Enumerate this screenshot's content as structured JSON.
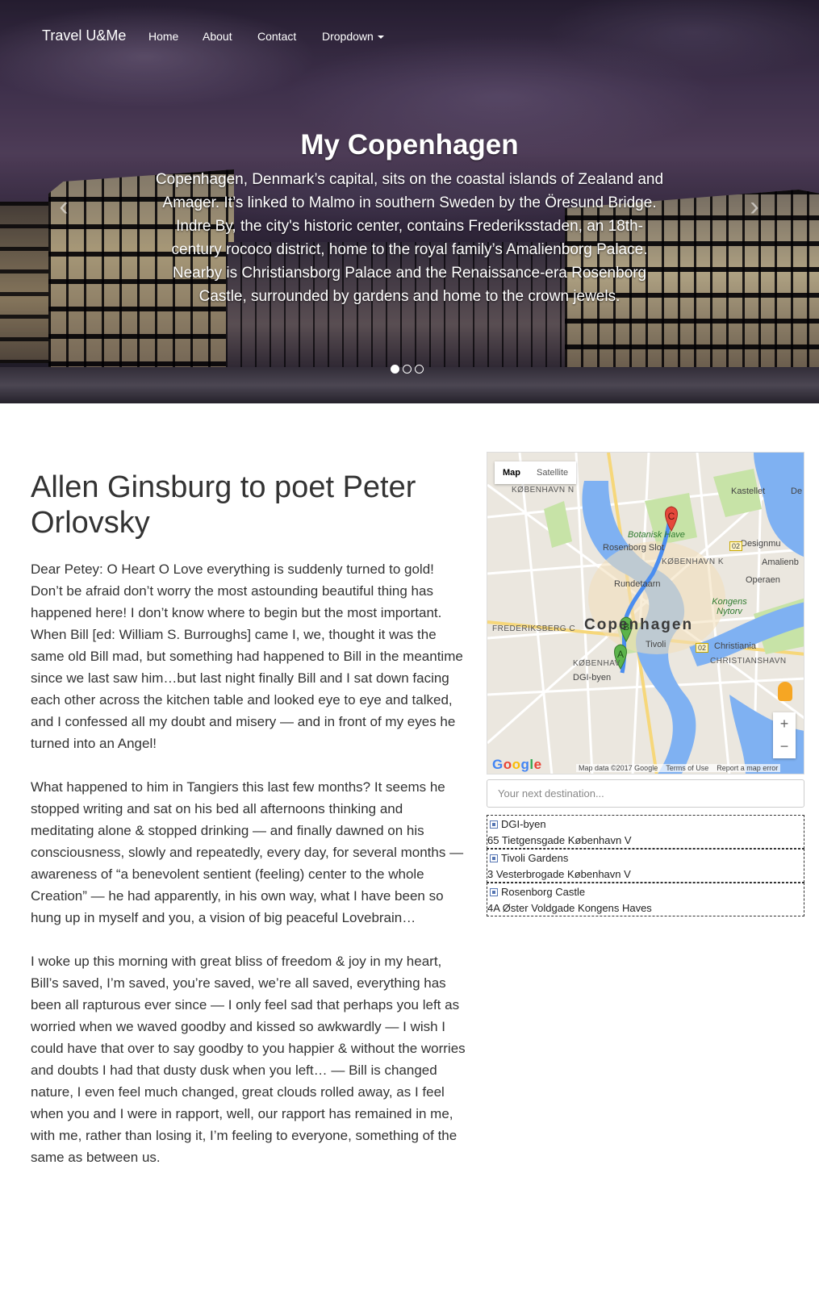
{
  "nav": {
    "brand": "Travel U&Me",
    "links": [
      "Home",
      "About",
      "Contact"
    ],
    "dropdown": "Dropdown"
  },
  "carousel": {
    "title": "My Copenhagen",
    "text": "Copenhagen, Denmark’s capital, sits on the coastal islands of Zealand and Amager. It’s linked to Malmo in southern Sweden by the Öresund Bridge. Indre By, the city's historic center, contains Frederiksstaden, an 18th-century rococo district, home to the royal family’s Amalienborg Palace. Nearby is Christiansborg Palace and the Renaissance-era Rosenborg Castle, surrounded by gardens and home to the crown jewels.",
    "prev": "‹",
    "next": "›",
    "slides": 3,
    "active_slide": 1
  },
  "article": {
    "title": "Allen Ginsburg to poet Peter Orlovsky",
    "paragraphs": [
      "Dear Petey: O Heart O Love everything is suddenly turned to gold! Don’t be afraid don’t worry the most astounding beautiful thing has happened here! I don’t know where to begin but the most important. When Bill [ed: William S. Burroughs] came I, we, thought it was the same old Bill mad, but something had happened to Bill in the meantime since we last saw him…but last night finally Bill and I sat down facing each other across the kitchen table and looked eye to eye and talked, and I confessed all my doubt and misery — and in front of my eyes he turned into an Angel!",
      "What happened to him in Tangiers this last few months? It seems he stopped writing and sat on his bed all afternoons thinking and meditating alone & stopped drinking — and finally dawned on his consciousness, slowly and repeatedly, every day, for several months — awareness of “a benevolent sentient (feeling) center to the whole Creation” — he had apparently, in his own way, what I have been so hung up in myself and you, a vision of big peaceful Lovebrain…",
      "I woke up this morning with great bliss of freedom & joy in my heart, Bill’s saved, I’m saved, you’re saved, we’re all saved, everything has been all rapturous ever since — I only feel sad that perhaps you left as worried when we waved goodby and kissed so awkwardly — I wish I could have that over to say goodby to you happier & without the worries and doubts I had that dusty dusk when you left… — Bill is changed nature, I even feel much changed, great clouds rolled away, as I feel when you and I were in rapport, well, our rapport has remained in me, with me, rather than losing it, I’m feeling to everyone, something of the same as between us."
    ]
  },
  "map": {
    "type_map": "Map",
    "type_satellite": "Satellite",
    "city_label": "Copenhagen",
    "labels": {
      "kobenhavn_n": "KØBENHAVN N",
      "kastellet": "Kastellet",
      "de": "De",
      "botanisk_have": "Botanisk Have",
      "rosenborg_slot": "Rosenborg Slot",
      "kobenhavn_k": "KØBENHAVN K",
      "designmuseum": "Designmu",
      "amalienborg": "Amalienb",
      "operaen": "Operaen",
      "rundetaarn": "Rundetaarn",
      "kongens_nytorv": "Kongens Nytorv",
      "frederiksberg": "FREDERIKSBERG C",
      "tivoli": "Tivoli",
      "christiania": "Christiania",
      "christianshavn": "CHRISTIANSHAVN",
      "kobenhavn_v": "KØBENHAV",
      "dgi_byen": "DGI-byen",
      "o2_a": "02",
      "o2_b": "02"
    },
    "markers": [
      "A",
      "B",
      "C"
    ],
    "zoom_in": "+",
    "zoom_out": "−",
    "google": [
      "G",
      "o",
      "o",
      "g",
      "l",
      "e"
    ],
    "footer": [
      "Map data ©2017 Google",
      "Terms of Use",
      "Report a map error"
    ],
    "colors": {
      "route": "#4a8df0",
      "water": "#7fb1f2",
      "park": "#c7e3a7",
      "marker_green": "#5cb44b",
      "marker_red": "#e5483b"
    }
  },
  "destination": {
    "placeholder": "Your next destination..."
  },
  "waypoints": [
    {
      "name": "DGI-byen",
      "address": "65 Tietgensgade København V"
    },
    {
      "name": "Tivoli Gardens",
      "address": "3 Vesterbrogade København V"
    },
    {
      "name": "Rosenborg Castle",
      "address": "4A Øster Voldgade Kongens Haves"
    }
  ]
}
